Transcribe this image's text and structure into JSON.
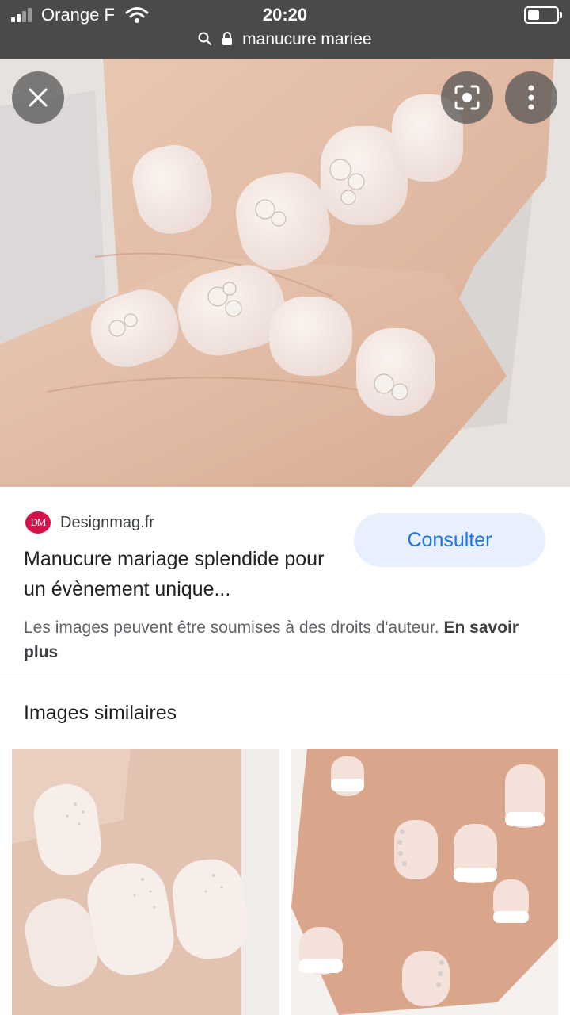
{
  "status_bar": {
    "carrier": "Orange F",
    "time": "20:20",
    "url": "manucure mariee"
  },
  "hero": {
    "close_label": "close",
    "lens_label": "lens",
    "more_label": "more"
  },
  "source": {
    "logo_text": "DM",
    "site": "Designmag.fr",
    "title": "Manucure mariage splendide pour un évènement unique...",
    "button": "Consulter"
  },
  "notice": {
    "text": "Les images peuvent être soumises à des droits d'auteur. ",
    "link": "En savoir plus"
  },
  "similar": {
    "heading": "Images similaires"
  },
  "colors": {
    "status_bg": "#4a4a4a",
    "accent": "#1a73e8",
    "button_bg": "#e8f0fe",
    "logo_bg": "#d8114b"
  }
}
